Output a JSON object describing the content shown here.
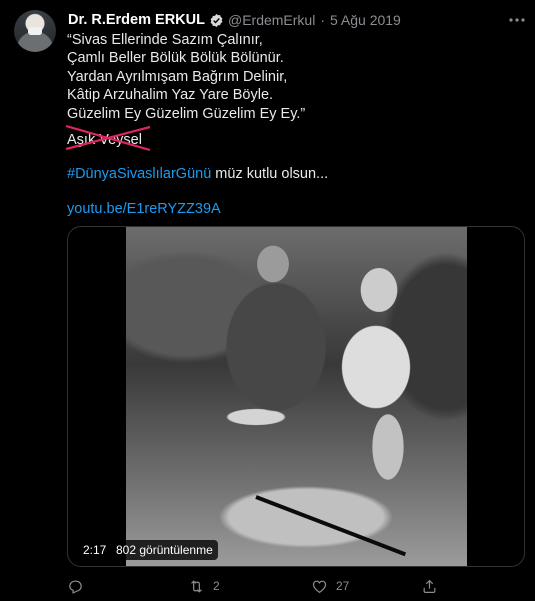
{
  "tweet": {
    "author": {
      "name": "Dr. R.Erdem ERKUL",
      "handle": "@ErdemErkul",
      "separator": "·",
      "date": "5 Ağu 2019"
    },
    "body_lines": [
      "“Sivas Ellerinde Sazım Çalınır,",
      "Çamlı Beller Bölük Bölük Bölünür.",
      "Yardan Ayrılmışam Bağrım Delinir,",
      "Kâtip Arzuhalim Yaz Yare Böyle.",
      "Güzelim Ey Güzelim Güzelim Ey Ey.”"
    ],
    "signature": "Aşık Veysel",
    "hashtag": "#DünyaSivaslılarGünü",
    "hashtag_suffix": " müz kutlu olsun...",
    "link": "youtu.be/E1reRYZZ39A",
    "media": {
      "duration": "2:17",
      "views": "802 görüntülenme"
    },
    "actions": {
      "reply_count": "",
      "retweet_count": "2",
      "like_count": "27"
    }
  },
  "icons": {
    "verified": "verified-badge-icon",
    "more": "more-icon",
    "reply": "reply-icon",
    "retweet": "retweet-icon",
    "like": "heart-icon",
    "share": "share-icon"
  },
  "colors": {
    "background": "#000000",
    "link": "#1d9bf0",
    "muted": "#8a8d91",
    "strike": "#e0245e"
  }
}
